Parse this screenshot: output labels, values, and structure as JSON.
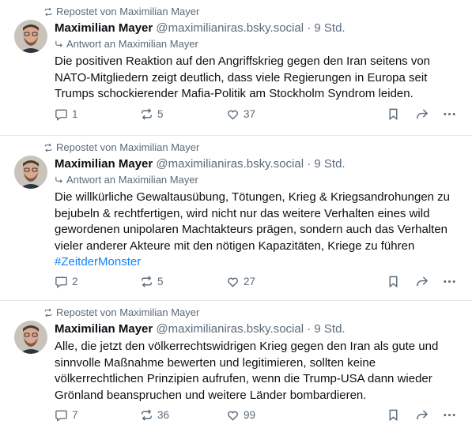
{
  "posts": [
    {
      "repost_label": "Repostet von Maximilian Mayer",
      "author_name": "Maximilian Mayer",
      "author_handle": "@maximilianiras.bsky.social",
      "time": "· 9 Std.",
      "reply_to": "Antwort an Maximilian Mayer",
      "text": "Die positiven Reaktion auf den Angriffskrieg gegen den Iran seitens von NATO-Mitgliedern zeigt deutlich, dass viele Regierungen in Europa seit Trumps schockierender Mafia-Politik am Stockholm Syndrom leiden.",
      "hashtag": "",
      "replies": "1",
      "reposts": "5",
      "likes": "37"
    },
    {
      "repost_label": "Repostet von Maximilian Mayer",
      "author_name": "Maximilian Mayer",
      "author_handle": "@maximilianiras.bsky.social",
      "time": "· 9 Std.",
      "reply_to": "Antwort an Maximilian Mayer",
      "text": "Die willkürliche Gewaltausübung, Tötungen, Krieg & Kriegsandrohungen zu bejubeln & rechtfertigen, wird nicht nur das weitere Verhalten eines wild gewordenen unipolaren Machtakteurs prägen, sondern auch das Verhalten vieler anderer Akteure mit den nötigen Kapazitäten, Kriege zu führen",
      "hashtag": "#ZeitderMonster",
      "replies": "2",
      "reposts": "5",
      "likes": "27"
    },
    {
      "repost_label": "Repostet von Maximilian Mayer",
      "author_name": "Maximilian Mayer",
      "author_handle": "@maximilianiras.bsky.social",
      "time": "· 9 Std.",
      "reply_to": "",
      "text": "Alle, die jetzt den völkerrechtswidrigen Krieg gegen den Iran als gute und sinnvolle Maßnahme bewerten und legitimieren, sollten keine völkerrechtlichen Prinzipien aufrufen, wenn die Trump-USA dann wieder Grönland beanspruchen und weitere Länder bombardieren.",
      "hashtag": "",
      "replies": "7",
      "reposts": "36",
      "likes": "99"
    }
  ],
  "colors": {
    "text": "#0b0f14",
    "muted": "#5b6a7a",
    "link": "#1083fe",
    "divider": "#e4e8ec"
  }
}
